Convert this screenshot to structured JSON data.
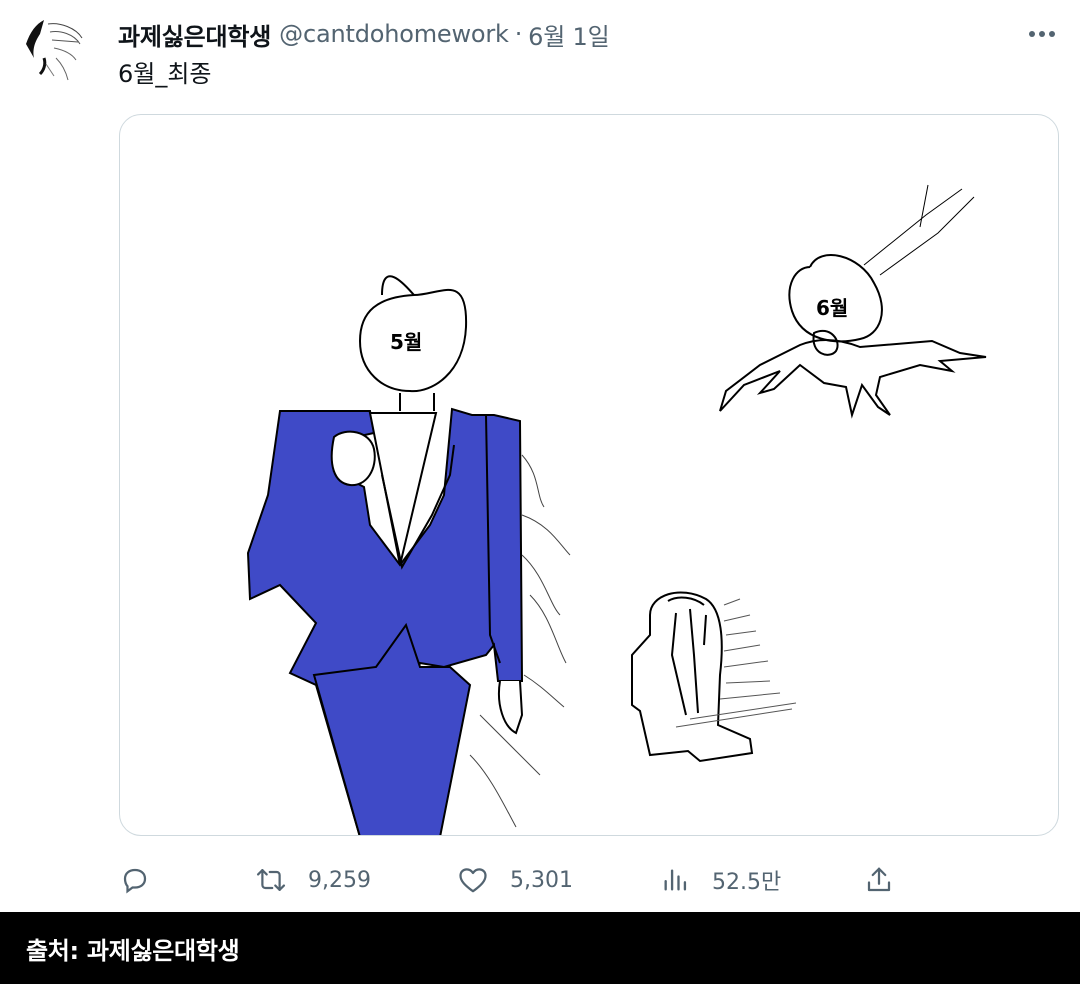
{
  "tweet": {
    "display_name": "과제싫은대학생",
    "handle": "@cantdohomework",
    "separator": "·",
    "date": "6월 1일",
    "text": "6월_최종",
    "more_icon": "more-horizontal-icon",
    "image": {
      "description_labels": {
        "left_head_label": "5월",
        "right_head_label": "6월"
      },
      "suit_color": "#3f4ac7"
    }
  },
  "actions": {
    "reply": {
      "icon": "reply-icon",
      "count": ""
    },
    "retweet": {
      "icon": "retweet-icon",
      "count": "9,259"
    },
    "like": {
      "icon": "heart-icon",
      "count": "5,301"
    },
    "views": {
      "icon": "bar-chart-icon",
      "count": "52.5만"
    },
    "share": {
      "icon": "share-icon",
      "count": ""
    }
  },
  "caption": {
    "text": "출처: 과제싫은대학생"
  },
  "colors": {
    "text_primary": "#0f1419",
    "text_secondary": "#536471",
    "border": "#cfd9de",
    "caption_bg": "#000000"
  }
}
